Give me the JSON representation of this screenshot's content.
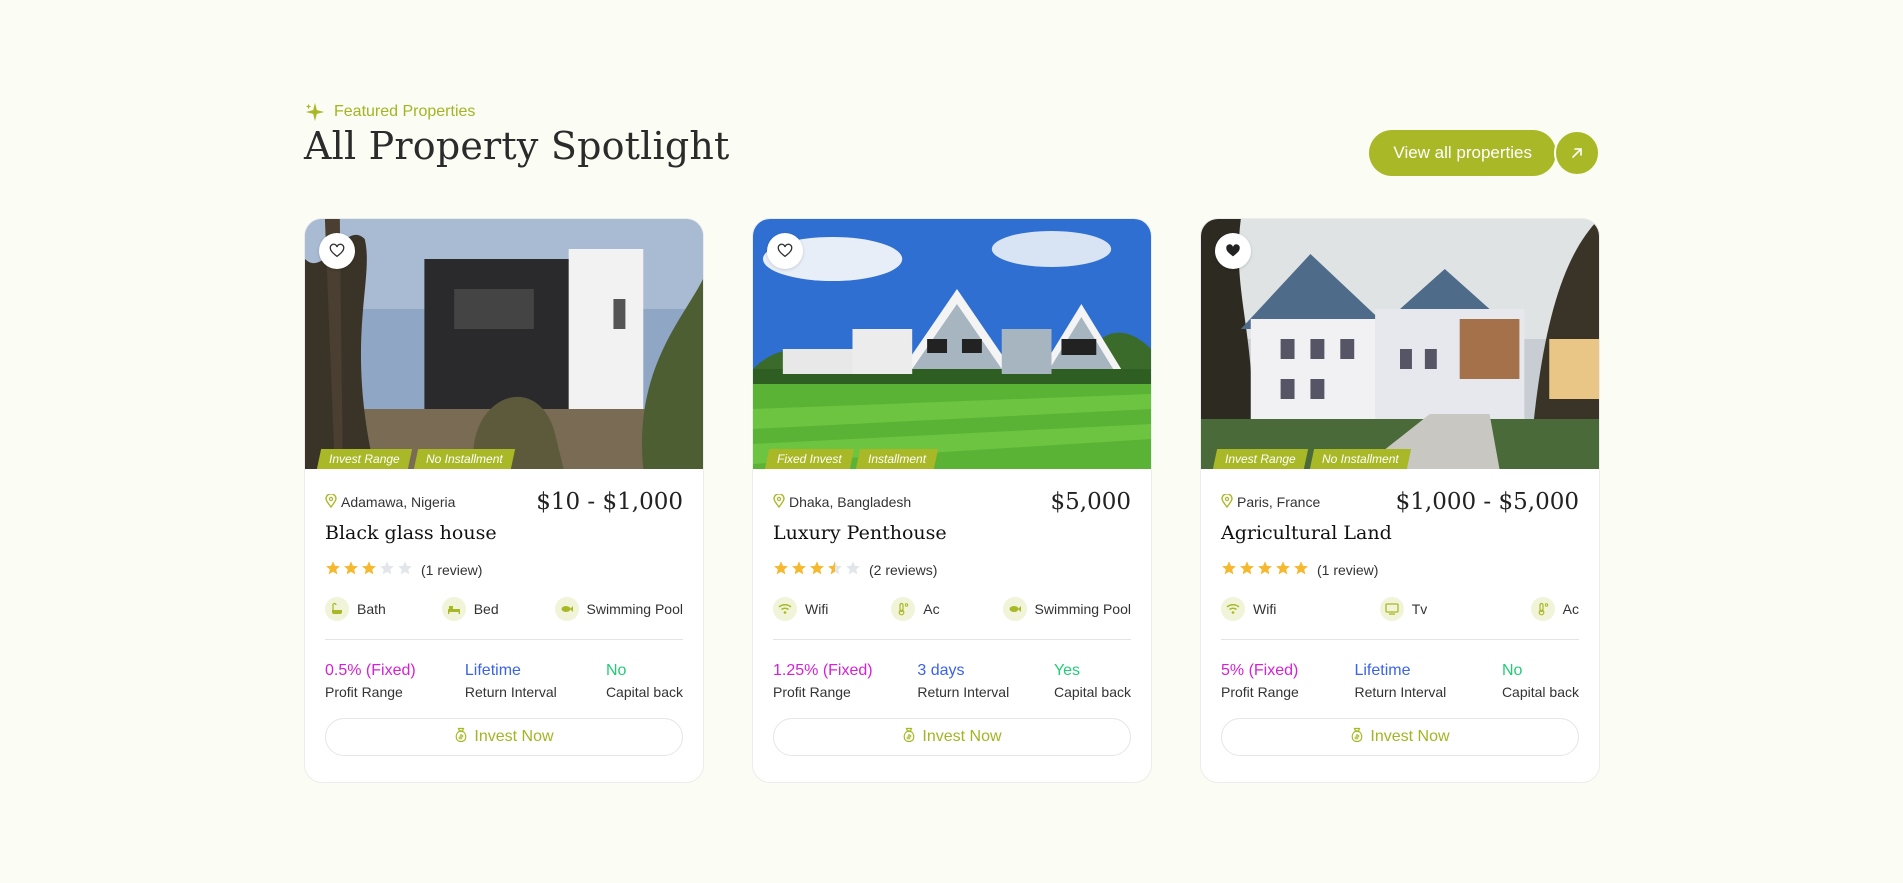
{
  "header": {
    "eyebrow": "Featured Properties",
    "title": "All Property Spotlight",
    "view_all_label": "View all properties"
  },
  "colors": {
    "accent": "#a9b827",
    "profit": "#d61fd6",
    "interval": "#3b63e6",
    "capital": "#22cc77",
    "star": "#f5b82e"
  },
  "cards": [
    {
      "favorited": false,
      "tags": [
        "Invest Range",
        "No Installment"
      ],
      "location": "Adamawa, Nigeria",
      "price": "$10 - $1,000",
      "name": "Black glass house",
      "rating": 3,
      "reviews": "(1 review)",
      "amenities": [
        {
          "icon": "bath-icon",
          "label": "Bath"
        },
        {
          "icon": "bed-icon",
          "label": "Bed"
        },
        {
          "icon": "fish-icon",
          "label": "Swimming Pool"
        }
      ],
      "profit": "0.5% (Fixed)",
      "profit_label": "Profit Range",
      "interval": "Lifetime",
      "interval_label": "Return Interval",
      "capital": "No",
      "capital_label": "Capital back",
      "cta": "Invest Now"
    },
    {
      "favorited": false,
      "tags": [
        "Fixed Invest",
        "Installment"
      ],
      "location": "Dhaka, Bangladesh",
      "price": "$5,000",
      "name": "Luxury Penthouse",
      "rating": 3.5,
      "reviews": "(2 reviews)",
      "amenities": [
        {
          "icon": "wifi-icon",
          "label": "Wifi"
        },
        {
          "icon": "thermometer-icon",
          "label": "Ac"
        },
        {
          "icon": "fish-icon",
          "label": "Swimming Pool"
        }
      ],
      "profit": "1.25% (Fixed)",
      "profit_label": "Profit Range",
      "interval": "3 days",
      "interval_label": "Return Interval",
      "capital": "Yes",
      "capital_label": "Capital back",
      "cta": "Invest Now"
    },
    {
      "favorited": true,
      "tags": [
        "Invest Range",
        "No Installment"
      ],
      "location": "Paris, France",
      "price": "$1,000 - $5,000",
      "name": "Agricultural Land",
      "rating": 5,
      "reviews": "(1 review)",
      "amenities": [
        {
          "icon": "wifi-icon",
          "label": "Wifi"
        },
        {
          "icon": "tv-icon",
          "label": "Tv"
        },
        {
          "icon": "thermometer-icon",
          "label": "Ac"
        }
      ],
      "profit": "5% (Fixed)",
      "profit_label": "Profit Range",
      "interval": "Lifetime",
      "interval_label": "Return Interval",
      "capital": "No",
      "capital_label": "Capital back",
      "cta": "Invest Now"
    }
  ]
}
